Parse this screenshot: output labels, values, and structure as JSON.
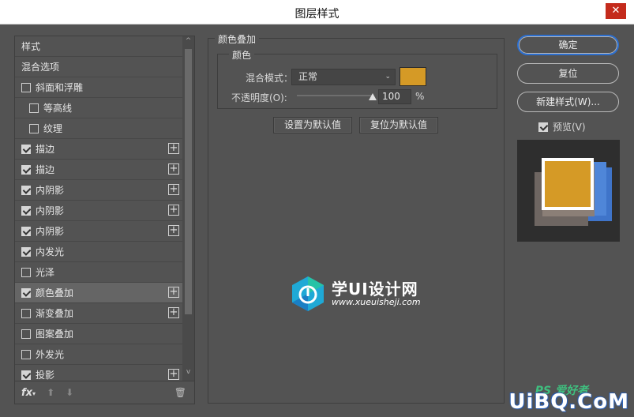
{
  "window": {
    "title": "图层样式",
    "close_glyph": "✕"
  },
  "styles_panel": {
    "items": [
      {
        "label": "样式",
        "kind": "plain",
        "checked": null,
        "plus": false,
        "selected": false
      },
      {
        "label": "混合选项",
        "kind": "plain",
        "checked": null,
        "plus": false,
        "selected": false
      },
      {
        "label": "斜面和浮雕",
        "kind": "check",
        "checked": false,
        "plus": false,
        "selected": false
      },
      {
        "label": "等高线",
        "kind": "indent",
        "checked": false,
        "plus": false,
        "selected": false
      },
      {
        "label": "纹理",
        "kind": "indent",
        "checked": false,
        "plus": false,
        "selected": false
      },
      {
        "label": "描边",
        "kind": "check",
        "checked": true,
        "plus": true,
        "selected": false
      },
      {
        "label": "描边",
        "kind": "check",
        "checked": true,
        "plus": true,
        "selected": false
      },
      {
        "label": "内阴影",
        "kind": "check",
        "checked": true,
        "plus": true,
        "selected": false
      },
      {
        "label": "内阴影",
        "kind": "check",
        "checked": true,
        "plus": true,
        "selected": false
      },
      {
        "label": "内阴影",
        "kind": "check",
        "checked": true,
        "plus": true,
        "selected": false
      },
      {
        "label": "内发光",
        "kind": "check",
        "checked": true,
        "plus": false,
        "selected": false
      },
      {
        "label": "光泽",
        "kind": "check",
        "checked": false,
        "plus": false,
        "selected": false
      },
      {
        "label": "颜色叠加",
        "kind": "check",
        "checked": true,
        "plus": true,
        "selected": true
      },
      {
        "label": "渐变叠加",
        "kind": "check",
        "checked": false,
        "plus": true,
        "selected": false
      },
      {
        "label": "图案叠加",
        "kind": "check",
        "checked": false,
        "plus": false,
        "selected": false
      },
      {
        "label": "外发光",
        "kind": "check",
        "checked": false,
        "plus": false,
        "selected": false
      },
      {
        "label": "投影",
        "kind": "check",
        "checked": true,
        "plus": true,
        "selected": false
      }
    ],
    "plus_glyph": "+",
    "fx_label": "fx",
    "fx_sub": "▾",
    "up_glyph": "⬆",
    "down_glyph": "⬇",
    "trash_glyph": "🗑",
    "scroll_up": "^",
    "scroll_down": "v"
  },
  "color_overlay": {
    "section_title": "颜色叠加",
    "group_title": "颜色",
    "blend_mode_label": "混合模式：",
    "blend_mode_value": "正常",
    "caret": "⌄",
    "color_hex": "#d59a26",
    "opacity_label": "不透明度(O):",
    "opacity_value": "100",
    "opacity_percent": 100,
    "opacity_unit": "%",
    "set_default_label": "设置为默认值",
    "reset_default_label": "复位为默认值"
  },
  "watermark": {
    "title": "学UI设计网",
    "url": "www.xueuisheji.com"
  },
  "right_panel": {
    "ok_label": "确定",
    "reset_label": "复位",
    "new_style_label": "新建样式(W)...",
    "preview_label": "预览(V)",
    "preview_checked": true
  },
  "corner_logo": {
    "small": "PS 爱好者",
    "big": "UiBQ.CoM"
  },
  "colors": {
    "accent": "#2c6fd0",
    "overlay": "#d59a26",
    "dialog_bg": "#535353"
  }
}
